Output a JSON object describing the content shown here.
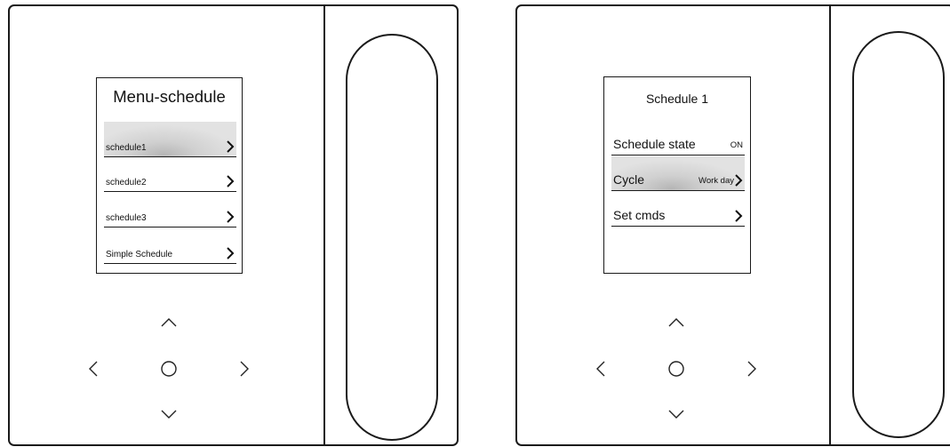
{
  "left_device": {
    "screen": {
      "title": "Menu-schedule",
      "items": [
        {
          "label": "schedule1",
          "selected": true
        },
        {
          "label": "schedule2",
          "selected": false
        },
        {
          "label": "schedule3",
          "selected": false
        },
        {
          "label": "Simple Schedule",
          "selected": false
        }
      ]
    },
    "icons": {
      "up": "chevron-up-icon",
      "down": "chevron-down-icon",
      "left": "chevron-left-icon",
      "right": "chevron-right-icon",
      "center": "circle-ok-icon"
    }
  },
  "right_device": {
    "screen": {
      "title": "Schedule 1",
      "items": [
        {
          "label": "Schedule state",
          "value": "ON",
          "selected": false
        },
        {
          "label": "Cycle",
          "value": "Work day",
          "selected": true
        },
        {
          "label": "Set cmds",
          "value": "",
          "selected": false
        }
      ]
    },
    "icons": {
      "up": "chevron-up-icon",
      "down": "chevron-down-icon",
      "left": "chevron-left-icon",
      "right": "chevron-right-icon",
      "center": "circle-ok-icon"
    }
  },
  "colors": {
    "outline": "#1a1a1a",
    "selection_highlight": "#c8c8c8",
    "background": "#ffffff"
  }
}
